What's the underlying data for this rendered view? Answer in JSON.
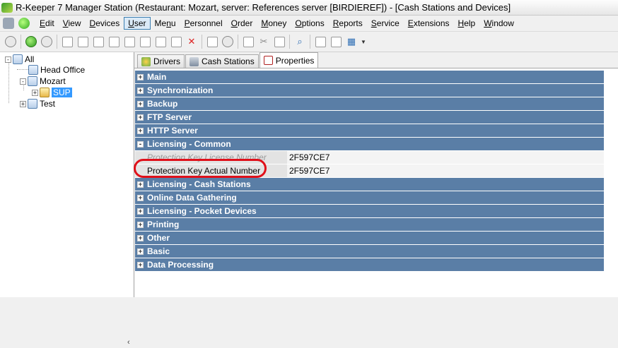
{
  "window": {
    "title": "R-Keeper 7 Manager Station (Restaurant: Mozart, server: References server [BIRDIEREF]) - [Cash Stations and Devices]"
  },
  "menu": [
    {
      "label": "Edit",
      "u": "E",
      "rest": "dit"
    },
    {
      "label": "View",
      "u": "V",
      "rest": "iew"
    },
    {
      "label": "Devices",
      "u": "D",
      "rest": "evices"
    },
    {
      "label": "User",
      "u": "U",
      "rest": "ser",
      "active": true
    },
    {
      "label": "Menu",
      "u": "",
      "rest": "Menu"
    },
    {
      "label": "Personnel",
      "u": "P",
      "rest": "ersonnel"
    },
    {
      "label": "Order",
      "u": "O",
      "rest": "rder"
    },
    {
      "label": "Money",
      "u": "M",
      "rest": "oney"
    },
    {
      "label": "Options",
      "u": "O",
      "rest": "ptions"
    },
    {
      "label": "Reports",
      "u": "R",
      "rest": "eports"
    },
    {
      "label": "Service",
      "u": "S",
      "rest": "ervice"
    },
    {
      "label": "Extensions",
      "u": "E",
      "rest": "xtensions"
    },
    {
      "label": "Help",
      "u": "H",
      "rest": "elp"
    },
    {
      "label": "Window",
      "u": "W",
      "rest": "indow"
    }
  ],
  "tree": {
    "all": "All",
    "head_office": "Head Office",
    "mozart": "Mozart",
    "sup": "SUP",
    "test": "Test"
  },
  "tabs": {
    "drivers": "Drivers",
    "cash_stations": "Cash Stations",
    "properties": "Properties"
  },
  "properties": {
    "main": "Main",
    "synchronization": "Synchronization",
    "backup": "Backup",
    "ftp_server": "FTP Server",
    "http_server": "HTTP Server",
    "licensing_common": "Licensing - Common",
    "protection_key_license_number": "Protection Key License Number",
    "protection_key_license_value": "2F597CE7",
    "protection_key_actual_number": "Protection Key Actual Number",
    "protection_key_actual_value": "2F597CE7",
    "licensing_cash_stations": "Licensing - Cash Stations",
    "online_data_gathering": "Online Data Gathering",
    "licensing_pocket_devices": "Licensing - Pocket Devices",
    "printing": "Printing",
    "other": "Other",
    "basic": "Basic",
    "data_processing": "Data Processing"
  },
  "symbols": {
    "plus": "+",
    "minus": "-"
  },
  "colors": {
    "category_bg": "#5a7ea6",
    "highlight_ring": "#e0101a",
    "selection": "#3399ff"
  }
}
